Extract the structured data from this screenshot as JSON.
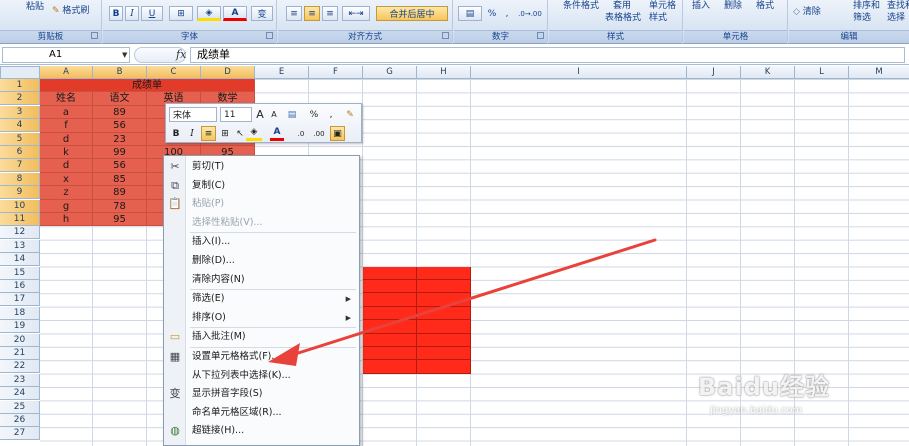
{
  "ribbon": {
    "clipboard": {
      "paste": "粘贴",
      "format_painter": "格式刷",
      "label": "剪贴板"
    },
    "font": {
      "bold": "B",
      "italic": "I",
      "underline": "U",
      "border": "⊞",
      "fill": "A",
      "font_color": "A",
      "phonetic": "变",
      "label": "字体"
    },
    "alignment": {
      "merge_center": "合并后居中",
      "label": "对齐方式"
    },
    "number": {
      "percent": "%",
      "comma": ",",
      "increase_decimal": ".0→.00",
      "label": "数字"
    },
    "styles": {
      "conditional_format": "条件格式",
      "format_as_table_1": "套用",
      "format_as_table_2": "表格格式",
      "cell_styles_1": "单元格",
      "cell_styles_2": "样式",
      "label": "样式"
    },
    "cells": {
      "insert": "插入",
      "delete": "删除",
      "format": "格式",
      "label": "单元格"
    },
    "editing": {
      "clear": "清除",
      "sort_filter_1": "排序和",
      "sort_filter_2": "筛选",
      "find_1": "查找和",
      "find_2": "选择",
      "label": "编辑"
    }
  },
  "formula_bar": {
    "name_box": "A1",
    "fx": "fx",
    "content": "成绩单"
  },
  "columns": [
    "A",
    "B",
    "C",
    "D",
    "E",
    "F",
    "G",
    "H",
    "I",
    "J",
    "K",
    "L",
    "M"
  ],
  "rows": [
    "1",
    "2",
    "3",
    "4",
    "5",
    "6",
    "7",
    "8",
    "9",
    "10",
    "11",
    "12",
    "13",
    "14",
    "15",
    "16",
    "17",
    "18",
    "19",
    "20",
    "21",
    "22",
    "23",
    "24",
    "25",
    "26",
    "27"
  ],
  "table": {
    "title": "成绩单",
    "headers": [
      "姓名",
      "语文",
      "英语",
      "数学"
    ],
    "names": [
      "a",
      "f",
      "d",
      "k",
      "d",
      "x",
      "z",
      "g",
      "h"
    ],
    "chinese": [
      "89",
      "56",
      "23",
      "99",
      "56",
      "85",
      "89",
      "78",
      "95"
    ],
    "row6_english": "100",
    "row6_math": "95"
  },
  "mini_toolbar": {
    "font_name": "宋体",
    "font_size": "11",
    "grow": "A",
    "shrink": "A",
    "percent": "%",
    "comma": ",",
    "bold": "B",
    "italic": "I",
    "font_color": "A",
    "decimal_inc": ".0",
    "decimal_dec": ".00"
  },
  "context_menu": {
    "items": [
      {
        "label": "剪切(T)",
        "icon": "scissors-icon",
        "disabled": false
      },
      {
        "label": "复制(C)",
        "icon": "copy-icon",
        "disabled": false
      },
      {
        "label": "粘贴(P)",
        "icon": "paste-icon",
        "disabled": true
      },
      {
        "label": "选择性粘贴(V)...",
        "icon": "",
        "disabled": true
      },
      {
        "label": "插入(I)...",
        "icon": "",
        "disabled": false
      },
      {
        "label": "删除(D)...",
        "icon": "",
        "disabled": false
      },
      {
        "label": "清除内容(N)",
        "icon": "",
        "disabled": false
      },
      {
        "label": "筛选(E)",
        "icon": "",
        "disabled": false,
        "submenu": true
      },
      {
        "label": "排序(O)",
        "icon": "",
        "disabled": false,
        "submenu": true
      },
      {
        "label": "插入批注(M)",
        "icon": "comment-icon",
        "disabled": false
      },
      {
        "label": "设置单元格格式(F)...",
        "icon": "format-cells-icon",
        "disabled": false
      },
      {
        "label": "从下拉列表中选择(K)...",
        "icon": "",
        "disabled": false
      },
      {
        "label": "显示拼音字段(S)",
        "icon": "phonetic-icon",
        "disabled": false
      },
      {
        "label": "命名单元格区域(R)...",
        "icon": "",
        "disabled": false
      },
      {
        "label": "超链接(H)...",
        "icon": "hyperlink-icon",
        "disabled": false
      }
    ]
  },
  "watermark": {
    "logo": "Baidu经验",
    "url": "jingyan.baidu.com"
  },
  "colors": {
    "table_red": "#e5604e",
    "bright_red": "#ff2a1a",
    "arrow_red": "#e8423a"
  }
}
